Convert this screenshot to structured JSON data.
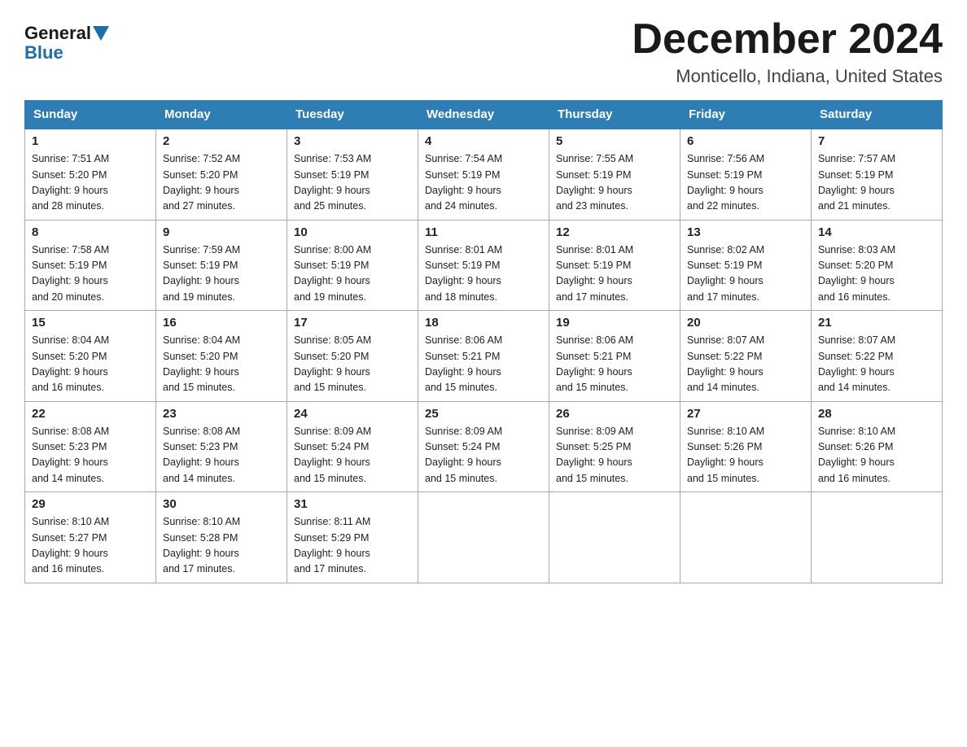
{
  "header": {
    "logo_general": "General",
    "logo_blue": "Blue",
    "month_title": "December 2024",
    "location": "Monticello, Indiana, United States"
  },
  "weekdays": [
    "Sunday",
    "Monday",
    "Tuesday",
    "Wednesday",
    "Thursday",
    "Friday",
    "Saturday"
  ],
  "weeks": [
    [
      {
        "day": "1",
        "sunrise": "7:51 AM",
        "sunset": "5:20 PM",
        "daylight": "9 hours and 28 minutes."
      },
      {
        "day": "2",
        "sunrise": "7:52 AM",
        "sunset": "5:20 PM",
        "daylight": "9 hours and 27 minutes."
      },
      {
        "day": "3",
        "sunrise": "7:53 AM",
        "sunset": "5:19 PM",
        "daylight": "9 hours and 25 minutes."
      },
      {
        "day": "4",
        "sunrise": "7:54 AM",
        "sunset": "5:19 PM",
        "daylight": "9 hours and 24 minutes."
      },
      {
        "day": "5",
        "sunrise": "7:55 AM",
        "sunset": "5:19 PM",
        "daylight": "9 hours and 23 minutes."
      },
      {
        "day": "6",
        "sunrise": "7:56 AM",
        "sunset": "5:19 PM",
        "daylight": "9 hours and 22 minutes."
      },
      {
        "day": "7",
        "sunrise": "7:57 AM",
        "sunset": "5:19 PM",
        "daylight": "9 hours and 21 minutes."
      }
    ],
    [
      {
        "day": "8",
        "sunrise": "7:58 AM",
        "sunset": "5:19 PM",
        "daylight": "9 hours and 20 minutes."
      },
      {
        "day": "9",
        "sunrise": "7:59 AM",
        "sunset": "5:19 PM",
        "daylight": "9 hours and 19 minutes."
      },
      {
        "day": "10",
        "sunrise": "8:00 AM",
        "sunset": "5:19 PM",
        "daylight": "9 hours and 19 minutes."
      },
      {
        "day": "11",
        "sunrise": "8:01 AM",
        "sunset": "5:19 PM",
        "daylight": "9 hours and 18 minutes."
      },
      {
        "day": "12",
        "sunrise": "8:01 AM",
        "sunset": "5:19 PM",
        "daylight": "9 hours and 17 minutes."
      },
      {
        "day": "13",
        "sunrise": "8:02 AM",
        "sunset": "5:19 PM",
        "daylight": "9 hours and 17 minutes."
      },
      {
        "day": "14",
        "sunrise": "8:03 AM",
        "sunset": "5:20 PM",
        "daylight": "9 hours and 16 minutes."
      }
    ],
    [
      {
        "day": "15",
        "sunrise": "8:04 AM",
        "sunset": "5:20 PM",
        "daylight": "9 hours and 16 minutes."
      },
      {
        "day": "16",
        "sunrise": "8:04 AM",
        "sunset": "5:20 PM",
        "daylight": "9 hours and 15 minutes."
      },
      {
        "day": "17",
        "sunrise": "8:05 AM",
        "sunset": "5:20 PM",
        "daylight": "9 hours and 15 minutes."
      },
      {
        "day": "18",
        "sunrise": "8:06 AM",
        "sunset": "5:21 PM",
        "daylight": "9 hours and 15 minutes."
      },
      {
        "day": "19",
        "sunrise": "8:06 AM",
        "sunset": "5:21 PM",
        "daylight": "9 hours and 15 minutes."
      },
      {
        "day": "20",
        "sunrise": "8:07 AM",
        "sunset": "5:22 PM",
        "daylight": "9 hours and 14 minutes."
      },
      {
        "day": "21",
        "sunrise": "8:07 AM",
        "sunset": "5:22 PM",
        "daylight": "9 hours and 14 minutes."
      }
    ],
    [
      {
        "day": "22",
        "sunrise": "8:08 AM",
        "sunset": "5:23 PM",
        "daylight": "9 hours and 14 minutes."
      },
      {
        "day": "23",
        "sunrise": "8:08 AM",
        "sunset": "5:23 PM",
        "daylight": "9 hours and 14 minutes."
      },
      {
        "day": "24",
        "sunrise": "8:09 AM",
        "sunset": "5:24 PM",
        "daylight": "9 hours and 15 minutes."
      },
      {
        "day": "25",
        "sunrise": "8:09 AM",
        "sunset": "5:24 PM",
        "daylight": "9 hours and 15 minutes."
      },
      {
        "day": "26",
        "sunrise": "8:09 AM",
        "sunset": "5:25 PM",
        "daylight": "9 hours and 15 minutes."
      },
      {
        "day": "27",
        "sunrise": "8:10 AM",
        "sunset": "5:26 PM",
        "daylight": "9 hours and 15 minutes."
      },
      {
        "day": "28",
        "sunrise": "8:10 AM",
        "sunset": "5:26 PM",
        "daylight": "9 hours and 16 minutes."
      }
    ],
    [
      {
        "day": "29",
        "sunrise": "8:10 AM",
        "sunset": "5:27 PM",
        "daylight": "9 hours and 16 minutes."
      },
      {
        "day": "30",
        "sunrise": "8:10 AM",
        "sunset": "5:28 PM",
        "daylight": "9 hours and 17 minutes."
      },
      {
        "day": "31",
        "sunrise": "8:11 AM",
        "sunset": "5:29 PM",
        "daylight": "9 hours and 17 minutes."
      },
      null,
      null,
      null,
      null
    ]
  ],
  "labels": {
    "sunrise": "Sunrise:",
    "sunset": "Sunset:",
    "daylight": "Daylight:"
  }
}
